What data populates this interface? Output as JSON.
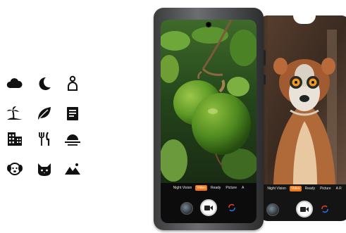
{
  "scene_icons": [
    {
      "name": "cloud-icon"
    },
    {
      "name": "moon-icon"
    },
    {
      "name": "portrait-icon"
    },
    {
      "name": "beach-icon"
    },
    {
      "name": "leaf-icon"
    },
    {
      "name": "document-icon"
    },
    {
      "name": "building-icon"
    },
    {
      "name": "food-icon"
    },
    {
      "name": "sunset-icon"
    },
    {
      "name": "dog-icon"
    },
    {
      "name": "cat-icon"
    },
    {
      "name": "landscape-icon"
    }
  ],
  "front_camera": {
    "modes": [
      "Night Vision",
      "Video",
      "Ready",
      "Picture",
      "A"
    ],
    "active_mode": "Video"
  },
  "rear_camera": {
    "modes": [
      "Night Vision",
      "Video",
      "Ready",
      "Picture",
      "A R"
    ],
    "active_mode": "Video"
  },
  "colors": {
    "accent": "#f07a1a",
    "icon": "#111111"
  }
}
